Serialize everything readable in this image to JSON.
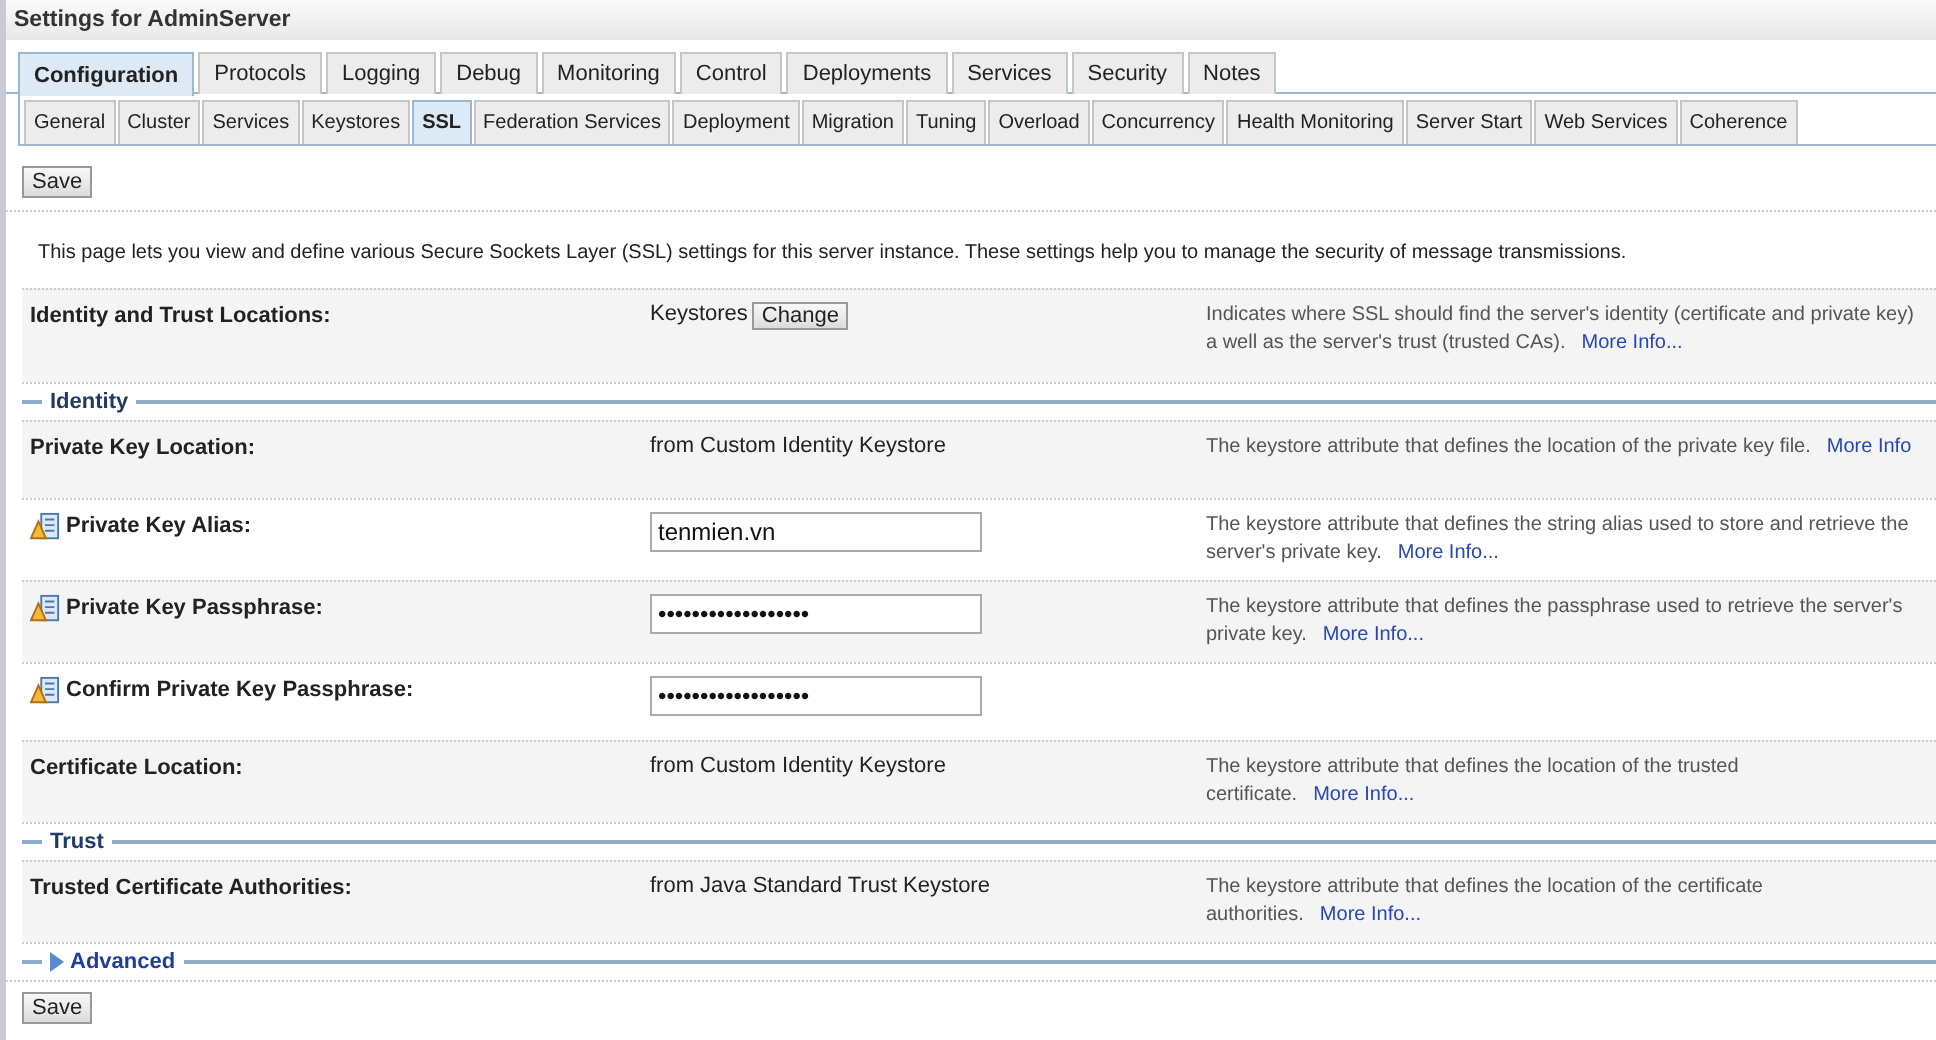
{
  "window": {
    "title": "Settings for AdminServer"
  },
  "tabs": [
    {
      "label": "Configuration",
      "selected": true
    },
    {
      "label": "Protocols",
      "selected": false
    },
    {
      "label": "Logging",
      "selected": false
    },
    {
      "label": "Debug",
      "selected": false
    },
    {
      "label": "Monitoring",
      "selected": false
    },
    {
      "label": "Control",
      "selected": false
    },
    {
      "label": "Deployments",
      "selected": false
    },
    {
      "label": "Services",
      "selected": false
    },
    {
      "label": "Security",
      "selected": false
    },
    {
      "label": "Notes",
      "selected": false
    }
  ],
  "subtabs": [
    {
      "label": "General",
      "selected": false
    },
    {
      "label": "Cluster",
      "selected": false
    },
    {
      "label": "Services",
      "selected": false
    },
    {
      "label": "Keystores",
      "selected": false
    },
    {
      "label": "SSL",
      "selected": true
    },
    {
      "label": "Federation Services",
      "selected": false
    },
    {
      "label": "Deployment",
      "selected": false
    },
    {
      "label": "Migration",
      "selected": false
    },
    {
      "label": "Tuning",
      "selected": false
    },
    {
      "label": "Overload",
      "selected": false
    },
    {
      "label": "Concurrency",
      "selected": false
    },
    {
      "label": "Health Monitoring",
      "selected": false
    },
    {
      "label": "Server Start",
      "selected": false
    },
    {
      "label": "Web Services",
      "selected": false
    },
    {
      "label": "Coherence",
      "selected": false
    }
  ],
  "save_button_top": "Save",
  "intro": "This page lets you view and define various Secure Sockets Layer (SSL) settings for this server instance. These settings help you to manage the security of message transmissions.",
  "locations_row": {
    "label": "Identity and Trust Locations:",
    "value": "Keystores",
    "button": "Change",
    "description": "Indicates where SSL should find the server's identity (certificate and private key) a well as the server's trust (trusted CAs).",
    "link": "More Info..."
  },
  "sections": [
    {
      "title": "Identity",
      "expanded": true,
      "rows": [
        {
          "kind": "text",
          "label": "Private Key Location:",
          "needs_restart": false,
          "value": "from Custom Identity Keystore",
          "description": "The keystore attribute that defines the location of the private key file.",
          "link": "More Info"
        },
        {
          "kind": "input",
          "label": "Private Key Alias:",
          "needs_restart": true,
          "value": "tenmien.vn",
          "description": "The keystore attribute that defines the string alias used to store and retrieve the server's private key.",
          "link": "More Info..."
        },
        {
          "kind": "input",
          "label": "Private Key Passphrase:",
          "needs_restart": true,
          "value": "••••••••••••••••••",
          "description": "The keystore attribute that defines the passphrase used to retrieve the server's private key.",
          "link": "More Info..."
        },
        {
          "kind": "input",
          "label": "Confirm Private Key Passphrase:",
          "needs_restart": true,
          "value": "••••••••••••••••••"
        },
        {
          "kind": "text",
          "label": "Certificate Location:",
          "needs_restart": false,
          "value": "from Custom Identity Keystore",
          "description": "The keystore attribute that defines the location of the trusted certificate.",
          "link": "More Info..."
        }
      ]
    },
    {
      "title": "Trust",
      "expanded": true,
      "rows": [
        {
          "kind": "text",
          "label": "Trusted Certificate Authorities:",
          "needs_restart": false,
          "value": "from Java Standard Trust Keystore",
          "description": "The keystore attribute that defines the location of the certificate authorities.",
          "link": "More Info..."
        }
      ]
    },
    {
      "title": "Advanced",
      "expanded": false
    }
  ],
  "save_button_bottom": "Save"
}
